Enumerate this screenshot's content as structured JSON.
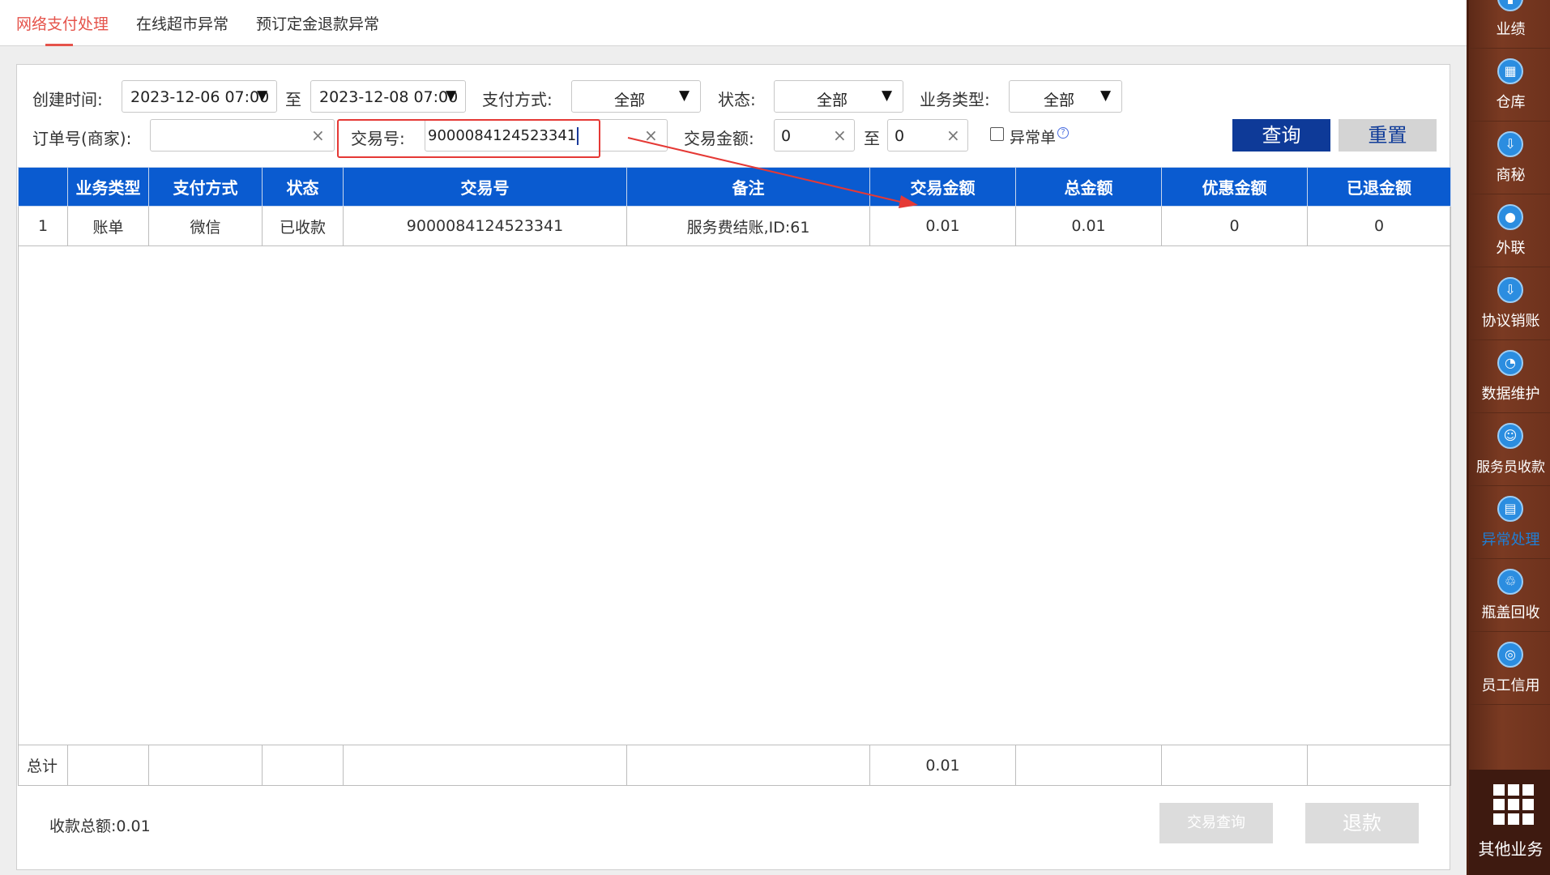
{
  "tabs": [
    "网络支付处理",
    "在线超市异常",
    "预订定金退款异常"
  ],
  "filters": {
    "create_time_label": "创建时间:",
    "start_date": "2023-12-06 07:00",
    "to_label": "至",
    "end_date": "2023-12-08 07:00",
    "pay_method_label": "支付方式:",
    "pay_method_value": "全部",
    "status_label": "状态:",
    "status_value": "全部",
    "biz_type_label": "业务类型:",
    "biz_type_value": "全部",
    "order_no_label": "订单号(商家):",
    "order_no_value": "",
    "txn_no_label": "交易号:",
    "txn_no_value": "9000084124523341",
    "txn_amount_label": "交易金额:",
    "amount_min": "0",
    "amount_max": "0",
    "abnormal_label": "异常单",
    "help_symbol": "?",
    "query_label": "查询",
    "reset_label": "重置"
  },
  "table": {
    "columns": [
      "",
      "业务类型",
      "支付方式",
      "状态",
      "交易号",
      "备注",
      "交易金额",
      "总金额",
      "优惠金额",
      "已退金额"
    ],
    "rows": [
      [
        "1",
        "账单",
        "微信",
        "已收款",
        "9000084124523341",
        "服务费结账,ID:61",
        "0.01",
        "0.01",
        "0",
        "0"
      ]
    ],
    "total_row": [
      "总计",
      "",
      "",
      "",
      "",
      "",
      "0.01",
      "",
      "",
      ""
    ]
  },
  "footer": {
    "total_label": "收款总额:",
    "total_value": "0.01",
    "txn_query_label": "交易查询",
    "refund_label": "退款"
  },
  "sidebar": {
    "items": [
      {
        "label": "业绩",
        "icon": "chart-icon"
      },
      {
        "label": "仓库",
        "icon": "warehouse-icon"
      },
      {
        "label": "商秘",
        "icon": "download-icon"
      },
      {
        "label": "外联",
        "icon": "contact-icon"
      },
      {
        "label": "协议销账",
        "icon": "download-icon"
      },
      {
        "label": "数据维护",
        "icon": "pie-icon"
      },
      {
        "label": "服务员收款",
        "icon": "user-icon"
      },
      {
        "label": "异常处理",
        "icon": "box-icon"
      },
      {
        "label": "瓶盖回收",
        "icon": "bottle-icon"
      },
      {
        "label": "员工信用",
        "icon": "credit-icon"
      }
    ],
    "more_label": "其他业务"
  },
  "colors": {
    "accent": "#e5534b",
    "header_blue": "#0a5bd0",
    "query_blue": "#0e3a98",
    "annotation_red": "#e53935",
    "sidebar_brown": "#7a3a22"
  }
}
